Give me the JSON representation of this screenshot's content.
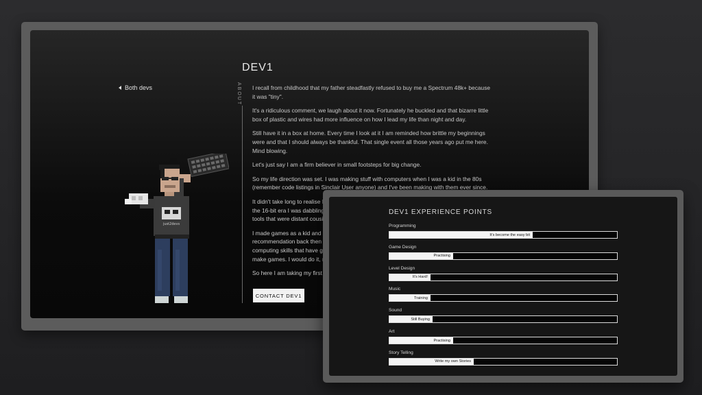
{
  "about": {
    "back_link": "Both devs",
    "title": "DEV1",
    "side_label": "ABOUT",
    "paragraphs": [
      "I recall from childhood that my father steadfastly refused to buy me a Spectrum 48k+ because it was \"tiny\".",
      "It's a ridiculous comment, we laugh about it now. Fortunately he buckled and that bizarre little box of plastic and wires had more influence on how I lead my life than night and day.",
      "Still have it in a box at home. Every time I look at it I am reminded how brittle my beginnings were and that I should always be thankful. That single event all those years ago put me here. Mind blowing.",
      "Let's just say I am a firm believer in small footsteps for big change.",
      "So my life direction was set. I was making stuff with computers when I was a kid in the 80s (remember code listings in Sinclair User anyone) and I've been making with them ever since.",
      "It didn't take long to realise I",
      "the 16-bit era I was dabbling",
      "tools that were distant cousi",
      "I made games as a kid and b",
      "recommendation back then",
      "computing skills that have g",
      "make games. I would do it, r",
      "So here I am taking my first s"
    ],
    "contact_label": "CONTACT DEV1",
    "figure_shirt_text": "just2devs"
  },
  "xp": {
    "title": "DEV1 EXPERIENCE POINTS",
    "skills": [
      {
        "name": "Programming",
        "level": 0.63,
        "status": "It's become the easy bit"
      },
      {
        "name": "Game Design",
        "level": 0.28,
        "status": "Practising"
      },
      {
        "name": "Level Design",
        "level": 0.18,
        "status": "It's Hard!"
      },
      {
        "name": "Music",
        "level": 0.18,
        "status": "Training"
      },
      {
        "name": "Sound",
        "level": 0.19,
        "status": "Still Buying"
      },
      {
        "name": "Art",
        "level": 0.28,
        "status": "Practising"
      },
      {
        "name": "Story Telling",
        "level": 0.37,
        "status": "Write my own Stories"
      }
    ]
  },
  "colors": {
    "frame": "#5c5c5c",
    "screen": "#0b0b0b",
    "bar_fill": "#f4f4f4"
  }
}
